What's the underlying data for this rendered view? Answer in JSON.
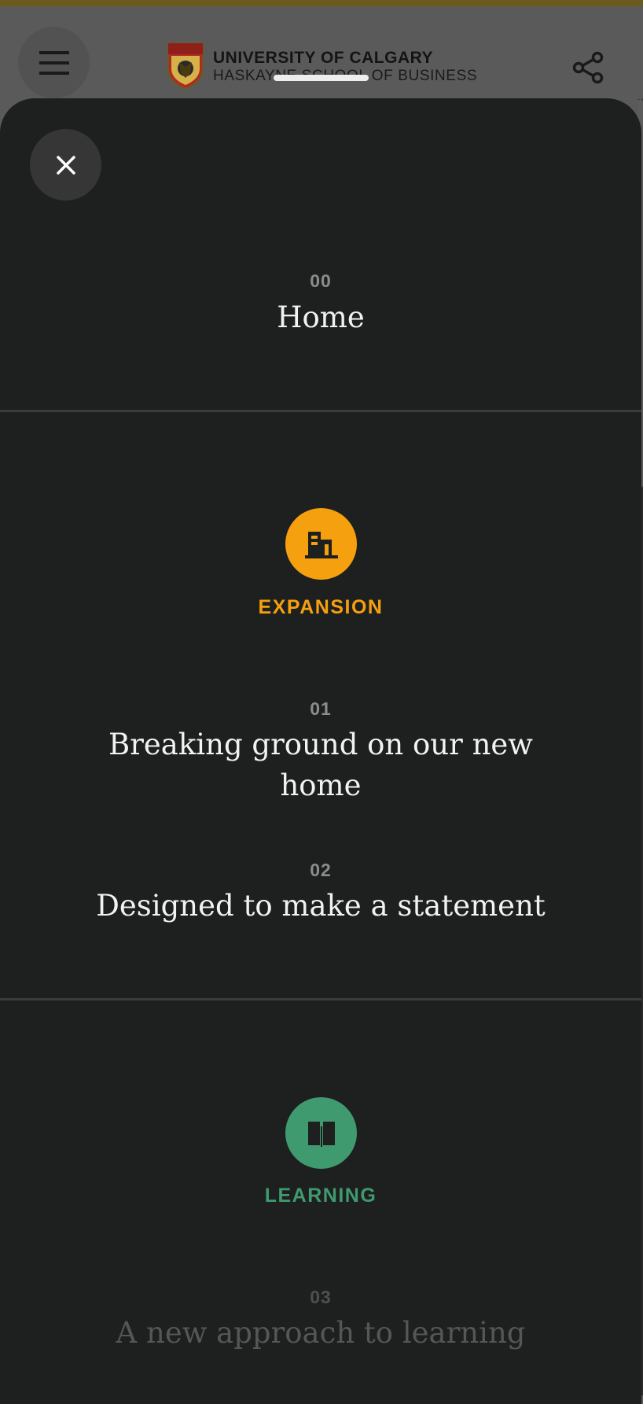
{
  "header": {
    "logo_line1": "UNIVERSITY OF CALGARY",
    "logo_line2": "HASKAYNE SCHOOL OF BUSINESS",
    "menu_icon": "hamburger-icon",
    "share_icon": "share-icon"
  },
  "menu": {
    "close_icon": "close-icon",
    "home": {
      "number": "00",
      "title": "Home"
    },
    "sections": [
      {
        "label": "EXPANSION",
        "icon": "building-icon",
        "color": "#f5a00e",
        "items": [
          {
            "number": "01",
            "title": "Breaking ground on our new home"
          },
          {
            "number": "02",
            "title": "Designed to make a statement"
          }
        ]
      },
      {
        "label": "LEARNING",
        "icon": "book-icon",
        "color": "#3f9a70",
        "items": [
          {
            "number": "03",
            "title": "A new approach to learning"
          }
        ]
      }
    ]
  }
}
